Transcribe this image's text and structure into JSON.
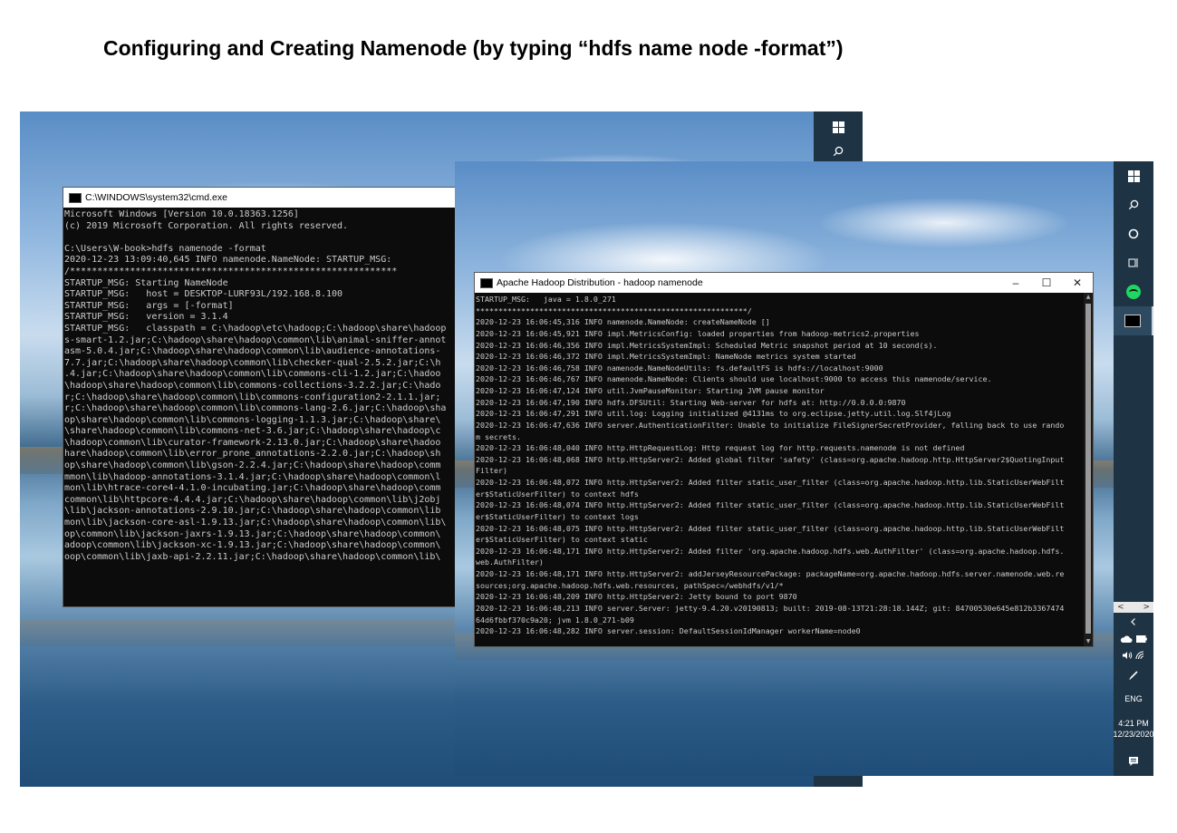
{
  "slide": {
    "title": "Configuring and Creating Namenode (by typing “hdfs name node -format”)"
  },
  "cmd_window": {
    "title": "C:\\WINDOWS\\system32\\cmd.exe",
    "lines": [
      "Microsoft Windows [Version 10.0.18363.1256]",
      "(c) 2019 Microsoft Corporation. All rights reserved.",
      "",
      "C:\\Users\\W-book>hdfs namenode -format",
      "2020-12-23 13:09:40,645 INFO namenode.NameNode: STARTUP_MSG:",
      "/************************************************************",
      "STARTUP_MSG: Starting NameNode",
      "STARTUP_MSG:   host = DESKTOP-LURF93L/192.168.8.100",
      "STARTUP_MSG:   args = [-format]",
      "STARTUP_MSG:   version = 3.1.4",
      "STARTUP_MSG:   classpath = C:\\hadoop\\etc\\hadoop;C:\\hadoop\\share\\hadoop",
      "s-smart-1.2.jar;C:\\hadoop\\share\\hadoop\\common\\lib\\animal-sniffer-annot",
      "asm-5.0.4.jar;C:\\hadoop\\share\\hadoop\\common\\lib\\audience-annotations-",
      "7.7.jar;C:\\hadoop\\share\\hadoop\\common\\lib\\checker-qual-2.5.2.jar;C:\\h",
      ".4.jar;C:\\hadoop\\share\\hadoop\\common\\lib\\commons-cli-1.2.jar;C:\\hadoo",
      "\\hadoop\\share\\hadoop\\common\\lib\\commons-collections-3.2.2.jar;C:\\hado",
      "r;C:\\hadoop\\share\\hadoop\\common\\lib\\commons-configuration2-2.1.1.jar;",
      "r;C:\\hadoop\\share\\hadoop\\common\\lib\\commons-lang-2.6.jar;C:\\hadoop\\sha",
      "op\\share\\hadoop\\common\\lib\\commons-logging-1.1.3.jar;C:\\hadoop\\share\\",
      "\\share\\hadoop\\common\\lib\\commons-net-3.6.jar;C:\\hadoop\\share\\hadoop\\c",
      "\\hadoop\\common\\lib\\curator-framework-2.13.0.jar;C:\\hadoop\\share\\hadoo",
      "hare\\hadoop\\common\\lib\\error_prone_annotations-2.2.0.jar;C:\\hadoop\\sh",
      "op\\share\\hadoop\\common\\lib\\gson-2.2.4.jar;C:\\hadoop\\share\\hadoop\\comm",
      "mmon\\lib\\hadoop-annotations-3.1.4.jar;C:\\hadoop\\share\\hadoop\\common\\l",
      "mon\\lib\\htrace-core4-4.1.0-incubating.jar;C:\\hadoop\\share\\hadoop\\comm",
      "common\\lib\\httpcore-4.4.4.jar;C:\\hadoop\\share\\hadoop\\common\\lib\\j2obj",
      "\\lib\\jackson-annotations-2.9.10.jar;C:\\hadoop\\share\\hadoop\\common\\lib",
      "mon\\lib\\jackson-core-asl-1.9.13.jar;C:\\hadoop\\share\\hadoop\\common\\lib\\",
      "op\\common\\lib\\jackson-jaxrs-1.9.13.jar;C:\\hadoop\\share\\hadoop\\common\\",
      "adoop\\common\\lib\\jackson-xc-1.9.13.jar;C:\\hadoop\\share\\hadoop\\common\\",
      "oop\\common\\lib\\jaxb-api-2.2.11.jar;C:\\hadoop\\share\\hadoop\\common\\lib\\"
    ]
  },
  "hadoop_window": {
    "title": "Apache Hadoop Distribution - hadoop   namenode",
    "controls": {
      "minimize": "–",
      "maximize": "☐",
      "close": "✕"
    },
    "lines": [
      "STARTUP_MSG:   java = 1.8.0_271",
      "************************************************************/",
      "2020-12-23 16:06:45,316 INFO namenode.NameNode: createNameNode []",
      "2020-12-23 16:06:45,921 INFO impl.MetricsConfig: loaded properties from hadoop-metrics2.properties",
      "2020-12-23 16:06:46,356 INFO impl.MetricsSystemImpl: Scheduled Metric snapshot period at 10 second(s).",
      "2020-12-23 16:06:46,372 INFO impl.MetricsSystemImpl: NameNode metrics system started",
      "2020-12-23 16:06:46,758 INFO namenode.NameNodeUtils: fs.defaultFS is hdfs://localhost:9000",
      "2020-12-23 16:06:46,767 INFO namenode.NameNode: Clients should use localhost:9000 to access this namenode/service.",
      "2020-12-23 16:06:47,124 INFO util.JvmPauseMonitor: Starting JVM pause monitor",
      "2020-12-23 16:06:47,190 INFO hdfs.DFSUtil: Starting Web-server for hdfs at: http://0.0.0.0:9870",
      "2020-12-23 16:06:47,291 INFO util.log: Logging initialized @4131ms to org.eclipse.jetty.util.log.Slf4jLog",
      "2020-12-23 16:06:47,636 INFO server.AuthenticationFilter: Unable to initialize FileSignerSecretProvider, falling back to use rando",
      "m secrets.",
      "2020-12-23 16:06:48,040 INFO http.HttpRequestLog: Http request log for http.requests.namenode is not defined",
      "2020-12-23 16:06:48,068 INFO http.HttpServer2: Added global filter 'safety' (class=org.apache.hadoop.http.HttpServer2$QuotingInput",
      "Filter)",
      "2020-12-23 16:06:48,072 INFO http.HttpServer2: Added filter static_user_filter (class=org.apache.hadoop.http.lib.StaticUserWebFilt",
      "er$StaticUserFilter) to context hdfs",
      "2020-12-23 16:06:48,074 INFO http.HttpServer2: Added filter static_user_filter (class=org.apache.hadoop.http.lib.StaticUserWebFilt",
      "er$StaticUserFilter) to context logs",
      "2020-12-23 16:06:48,075 INFO http.HttpServer2: Added filter static_user_filter (class=org.apache.hadoop.http.lib.StaticUserWebFilt",
      "er$StaticUserFilter) to context static",
      "2020-12-23 16:06:48,171 INFO http.HttpServer2: Added filter 'org.apache.hadoop.hdfs.web.AuthFilter' (class=org.apache.hadoop.hdfs.",
      "web.AuthFilter)",
      "2020-12-23 16:06:48,171 INFO http.HttpServer2: addJerseyResourcePackage: packageName=org.apache.hadoop.hdfs.server.namenode.web.re",
      "sources;org.apache.hadoop.hdfs.web.resources, pathSpec=/webhdfs/v1/*",
      "2020-12-23 16:06:48,209 INFO http.HttpServer2: Jetty bound to port 9870",
      "2020-12-23 16:06:48,213 INFO server.Server: jetty-9.4.20.v20190813; built: 2019-08-13T21:28:18.144Z; git: 84700530e645e812b3367474",
      "64d6fbbf370c9a20; jvm 1.8.0_271-b09",
      "2020-12-23 16:06:48,282 INFO server.session: DefaultSessionIdManager workerName=node0"
    ]
  },
  "taskbar": {
    "language": "ENG",
    "time": "4:21 PM",
    "date": "12/23/2020",
    "scroll_left": "<",
    "scroll_right": ">"
  }
}
